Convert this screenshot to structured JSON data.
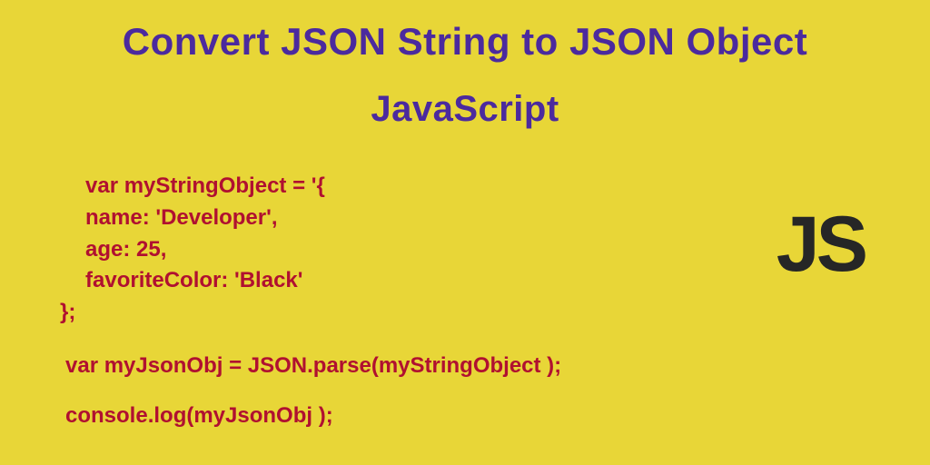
{
  "title": "Convert JSON String to JSON Object",
  "subtitle": "JavaScript",
  "code": {
    "block1_line1": "var myStringObject = '{",
    "block1_line2": "name: 'Developer',",
    "block1_line3": "age: 25,",
    "block1_line4": "favoriteColor: 'Black'",
    "block1_line5": "};",
    "block2": "var myJsonObj = JSON.parse(myStringObject );",
    "block3": "console.log(myJsonObj );"
  },
  "badge": "JS"
}
